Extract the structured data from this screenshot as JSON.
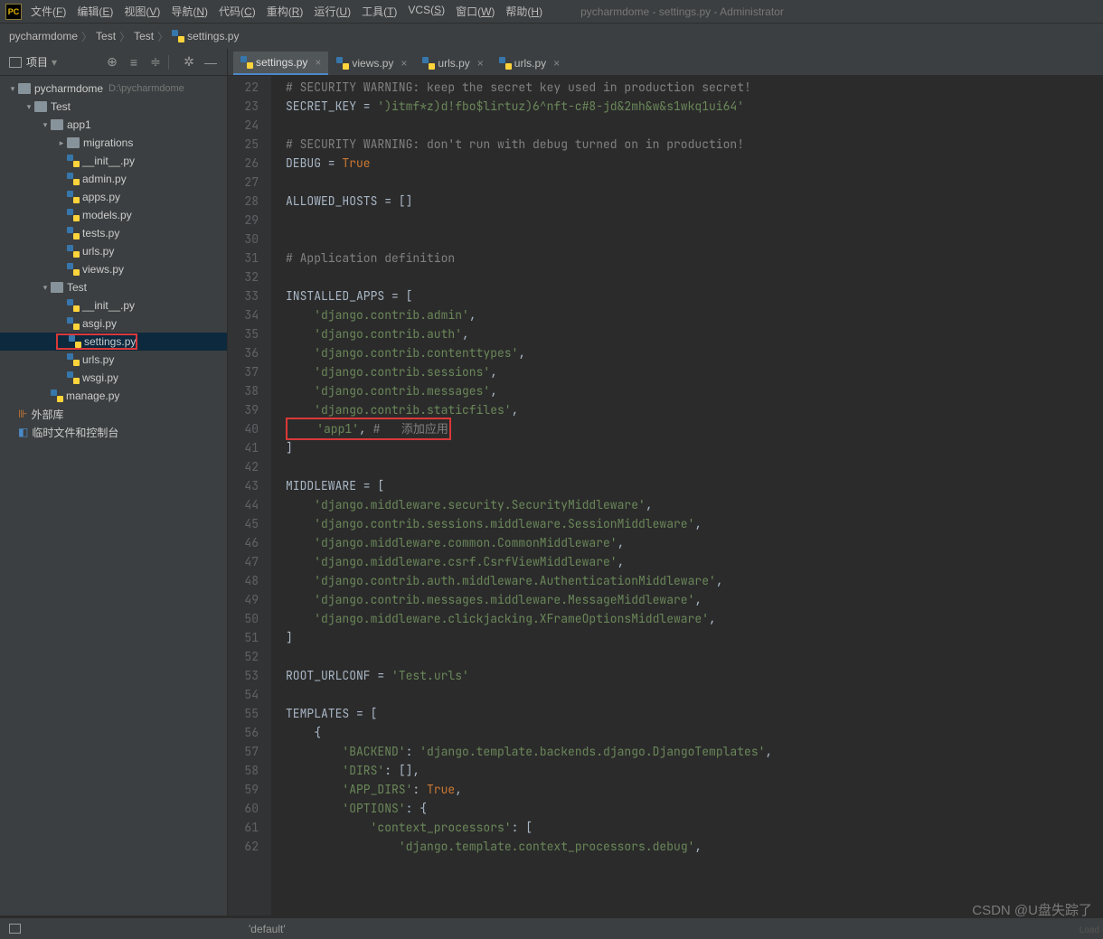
{
  "window_title": "pycharmdome - settings.py - Administrator",
  "menu": [
    {
      "t": "文件",
      "k": "F"
    },
    {
      "t": "编辑",
      "k": "E"
    },
    {
      "t": "视图",
      "k": "V"
    },
    {
      "t": "导航",
      "k": "N"
    },
    {
      "t": "代码",
      "k": "C"
    },
    {
      "t": "重构",
      "k": "R"
    },
    {
      "t": "运行",
      "k": "U"
    },
    {
      "t": "工具",
      "k": "T"
    },
    {
      "t": "VCS",
      "k": "S"
    },
    {
      "t": "窗口",
      "k": "W"
    },
    {
      "t": "帮助",
      "k": "H"
    }
  ],
  "breadcrumb": [
    "pycharmdome",
    "Test",
    "Test",
    "settings.py"
  ],
  "tool": {
    "title": "项目"
  },
  "tree": [
    {
      "d": 0,
      "a": "▾",
      "ic": "fld",
      "n": "pycharmdome",
      "dim": "D:\\pycharmdome"
    },
    {
      "d": 1,
      "a": "▾",
      "ic": "fld",
      "n": "Test"
    },
    {
      "d": 2,
      "a": "▾",
      "ic": "fld",
      "n": "app1"
    },
    {
      "d": 3,
      "a": "▸",
      "ic": "fld",
      "n": "migrations"
    },
    {
      "d": 3,
      "a": "",
      "ic": "py",
      "n": "__init__.py"
    },
    {
      "d": 3,
      "a": "",
      "ic": "py",
      "n": "admin.py"
    },
    {
      "d": 3,
      "a": "",
      "ic": "py",
      "n": "apps.py"
    },
    {
      "d": 3,
      "a": "",
      "ic": "py",
      "n": "models.py"
    },
    {
      "d": 3,
      "a": "",
      "ic": "py",
      "n": "tests.py"
    },
    {
      "d": 3,
      "a": "",
      "ic": "py",
      "n": "urls.py"
    },
    {
      "d": 3,
      "a": "",
      "ic": "py",
      "n": "views.py"
    },
    {
      "d": 2,
      "a": "▾",
      "ic": "fld",
      "n": "Test"
    },
    {
      "d": 3,
      "a": "",
      "ic": "py",
      "n": "__init__.py"
    },
    {
      "d": 3,
      "a": "",
      "ic": "py",
      "n": "asgi.py"
    },
    {
      "d": 3,
      "a": "",
      "ic": "py",
      "n": "settings.py",
      "sel": true,
      "red": true
    },
    {
      "d": 3,
      "a": "",
      "ic": "py",
      "n": "urls.py"
    },
    {
      "d": 3,
      "a": "",
      "ic": "py",
      "n": "wsgi.py"
    },
    {
      "d": 2,
      "a": "",
      "ic": "py",
      "n": "manage.py"
    },
    {
      "d": 0,
      "a": "",
      "ic": "lib",
      "n": "外部库"
    },
    {
      "d": 0,
      "a": "",
      "ic": "scr",
      "n": "临时文件和控制台"
    }
  ],
  "tabs": [
    {
      "n": "settings.py",
      "act": true
    },
    {
      "n": "views.py"
    },
    {
      "n": "urls.py"
    },
    {
      "n": "urls.py"
    }
  ],
  "editor": {
    "first_line": 22,
    "lines": [
      {
        "t": "cmt",
        "v": "# SECURITY WARNING: keep the secret key used in production secret!"
      },
      {
        "t": "mix",
        "parts": [
          {
            "c": "pl",
            "v": "SECRET_KEY = "
          },
          {
            "c": "str",
            "v": "')itmf*z)d!fbo$lirtuz)6^nft-c#8-jd&2mh&w&s1wkq1ui64'"
          }
        ]
      },
      {
        "t": "pl",
        "v": ""
      },
      {
        "t": "cmt",
        "v": "# SECURITY WARNING: don't run with debug turned on in production!"
      },
      {
        "t": "mix",
        "parts": [
          {
            "c": "pl",
            "v": "DEBUG = "
          },
          {
            "c": "kw",
            "v": "True"
          }
        ]
      },
      {
        "t": "pl",
        "v": ""
      },
      {
        "t": "pl",
        "v": "ALLOWED_HOSTS = []"
      },
      {
        "t": "pl",
        "v": ""
      },
      {
        "t": "pl",
        "v": ""
      },
      {
        "t": "cmt",
        "v": "# Application definition"
      },
      {
        "t": "pl",
        "v": ""
      },
      {
        "t": "pl",
        "v": "INSTALLED_APPS = ["
      },
      {
        "t": "mix",
        "parts": [
          {
            "c": "pl",
            "v": "    "
          },
          {
            "c": "str",
            "v": "'django.contrib.admin'"
          },
          {
            "c": "pl",
            "v": ","
          }
        ]
      },
      {
        "t": "mix",
        "parts": [
          {
            "c": "pl",
            "v": "    "
          },
          {
            "c": "str",
            "v": "'django.contrib.auth'"
          },
          {
            "c": "pl",
            "v": ","
          }
        ]
      },
      {
        "t": "mix",
        "parts": [
          {
            "c": "pl",
            "v": "    "
          },
          {
            "c": "str",
            "v": "'django.contrib.contenttypes'"
          },
          {
            "c": "pl",
            "v": ","
          }
        ]
      },
      {
        "t": "mix",
        "parts": [
          {
            "c": "pl",
            "v": "    "
          },
          {
            "c": "str",
            "v": "'django.contrib.sessions'"
          },
          {
            "c": "pl",
            "v": ","
          }
        ]
      },
      {
        "t": "mix",
        "parts": [
          {
            "c": "pl",
            "v": "    "
          },
          {
            "c": "str",
            "v": "'django.contrib.messages'"
          },
          {
            "c": "pl",
            "v": ","
          }
        ]
      },
      {
        "t": "mix",
        "parts": [
          {
            "c": "pl",
            "v": "    "
          },
          {
            "c": "str",
            "v": "'django.contrib.staticfiles'"
          },
          {
            "c": "pl",
            "v": ","
          }
        ]
      },
      {
        "t": "hlred",
        "parts": [
          {
            "c": "pl",
            "v": "    "
          },
          {
            "c": "str",
            "v": "'app1'"
          },
          {
            "c": "pl",
            "v": ", "
          },
          {
            "c": "cmt",
            "v": "#   添加应用"
          }
        ]
      },
      {
        "t": "pl",
        "v": "]"
      },
      {
        "t": "pl",
        "v": ""
      },
      {
        "t": "pl",
        "v": "MIDDLEWARE = ["
      },
      {
        "t": "mix",
        "parts": [
          {
            "c": "pl",
            "v": "    "
          },
          {
            "c": "str",
            "v": "'django.middleware.security.SecurityMiddleware'"
          },
          {
            "c": "pl",
            "v": ","
          }
        ]
      },
      {
        "t": "mix",
        "parts": [
          {
            "c": "pl",
            "v": "    "
          },
          {
            "c": "str",
            "v": "'django.contrib.sessions.middleware.SessionMiddleware'"
          },
          {
            "c": "pl",
            "v": ","
          }
        ]
      },
      {
        "t": "mix",
        "parts": [
          {
            "c": "pl",
            "v": "    "
          },
          {
            "c": "str",
            "v": "'django.middleware.common.CommonMiddleware'"
          },
          {
            "c": "pl",
            "v": ","
          }
        ]
      },
      {
        "t": "mix",
        "parts": [
          {
            "c": "pl",
            "v": "    "
          },
          {
            "c": "str",
            "v": "'django.middleware.csrf.CsrfViewMiddleware'"
          },
          {
            "c": "pl",
            "v": ","
          }
        ]
      },
      {
        "t": "mix",
        "parts": [
          {
            "c": "pl",
            "v": "    "
          },
          {
            "c": "str",
            "v": "'django.contrib.auth.middleware.AuthenticationMiddleware'"
          },
          {
            "c": "pl",
            "v": ","
          }
        ]
      },
      {
        "t": "mix",
        "parts": [
          {
            "c": "pl",
            "v": "    "
          },
          {
            "c": "str",
            "v": "'django.contrib.messages.middleware.MessageMiddleware'"
          },
          {
            "c": "pl",
            "v": ","
          }
        ]
      },
      {
        "t": "mix",
        "parts": [
          {
            "c": "pl",
            "v": "    "
          },
          {
            "c": "str",
            "v": "'django.middleware.clickjacking.XFrameOptionsMiddleware'"
          },
          {
            "c": "pl",
            "v": ","
          }
        ]
      },
      {
        "t": "pl",
        "v": "]"
      },
      {
        "t": "pl",
        "v": ""
      },
      {
        "t": "mix",
        "parts": [
          {
            "c": "pl",
            "v": "ROOT_URLCONF = "
          },
          {
            "c": "str",
            "v": "'Test.urls'"
          }
        ]
      },
      {
        "t": "pl",
        "v": ""
      },
      {
        "t": "pl",
        "v": "TEMPLATES = ["
      },
      {
        "t": "pl",
        "v": "    {"
      },
      {
        "t": "mix",
        "parts": [
          {
            "c": "pl",
            "v": "        "
          },
          {
            "c": "str",
            "v": "'BACKEND'"
          },
          {
            "c": "pl",
            "v": ": "
          },
          {
            "c": "str",
            "v": "'django.template.backends.django.DjangoTemplates'"
          },
          {
            "c": "pl",
            "v": ","
          }
        ]
      },
      {
        "t": "mix",
        "parts": [
          {
            "c": "pl",
            "v": "        "
          },
          {
            "c": "str",
            "v": "'DIRS'"
          },
          {
            "c": "pl",
            "v": ": [],"
          }
        ]
      },
      {
        "t": "mix",
        "parts": [
          {
            "c": "pl",
            "v": "        "
          },
          {
            "c": "str",
            "v": "'APP_DIRS'"
          },
          {
            "c": "pl",
            "v": ": "
          },
          {
            "c": "kw",
            "v": "True"
          },
          {
            "c": "pl",
            "v": ","
          }
        ]
      },
      {
        "t": "mix",
        "parts": [
          {
            "c": "pl",
            "v": "        "
          },
          {
            "c": "str",
            "v": "'OPTIONS'"
          },
          {
            "c": "pl",
            "v": ": {"
          }
        ]
      },
      {
        "t": "mix",
        "parts": [
          {
            "c": "pl",
            "v": "            "
          },
          {
            "c": "str",
            "v": "'context_processors'"
          },
          {
            "c": "pl",
            "v": ": ["
          }
        ]
      },
      {
        "t": "mix",
        "parts": [
          {
            "c": "pl",
            "v": "                "
          },
          {
            "c": "str",
            "v": "'django.template.context_processors.debug'"
          },
          {
            "c": "pl",
            "v": ","
          }
        ]
      }
    ]
  },
  "status_left": "'default'",
  "watermark": "CSDN @U盘失踪了",
  "load": "Load"
}
